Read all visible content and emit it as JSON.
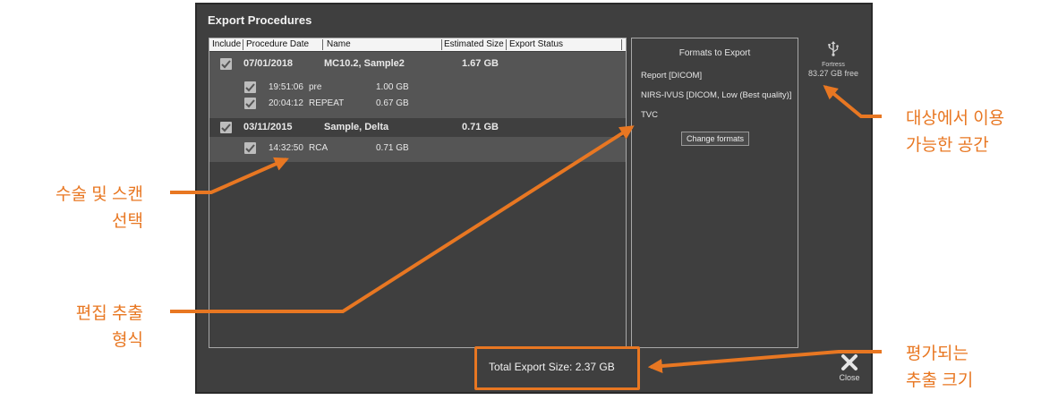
{
  "window": {
    "title": "Export Procedures"
  },
  "table": {
    "columns": [
      "Include",
      "Procedure Date",
      "Name",
      "Estimated Size",
      "Export Status"
    ],
    "groups": [
      {
        "date": "07/01/2018",
        "name": "MC10.2, Sample2",
        "size": "1.67 GB",
        "scans": [
          {
            "time": "19:51:06",
            "name": "pre",
            "size": "1.00 GB"
          },
          {
            "time": "20:04:12",
            "name": "REPEAT",
            "size": "0.67 GB"
          }
        ]
      },
      {
        "date": "03/11/2015",
        "name": "Sample, Delta",
        "size": "0.71 GB",
        "scans": [
          {
            "time": "14:32:50",
            "name": "RCA",
            "size": "0.71 GB"
          }
        ]
      }
    ]
  },
  "formats": {
    "title": "Formats to Export",
    "items": [
      "Report [DICOM]",
      "NIRS-IVUS [DICOM, Low (Best quality)]",
      "TVC"
    ],
    "change_button": "Change formats"
  },
  "destination": {
    "icon": "usb-icon",
    "name": "Fortress",
    "free": "83.27 GB free"
  },
  "footer": {
    "total": "Total Export Size: 2.37 GB",
    "close_label": "Close",
    "close_icon": "close-icon"
  },
  "annotations": {
    "select_line1": "수술 및 스캔",
    "select_line2": "선택",
    "edit_line1": "편집 추출",
    "edit_line2": "형식",
    "space_line1": "대상에서 이용",
    "space_line2": "가능한 공간",
    "size_line1": "평가되는",
    "size_line2": "추출 크기"
  },
  "colors": {
    "accent": "#e87722",
    "window_bg": "#3f3f3f",
    "row_highlight": "#555555"
  }
}
